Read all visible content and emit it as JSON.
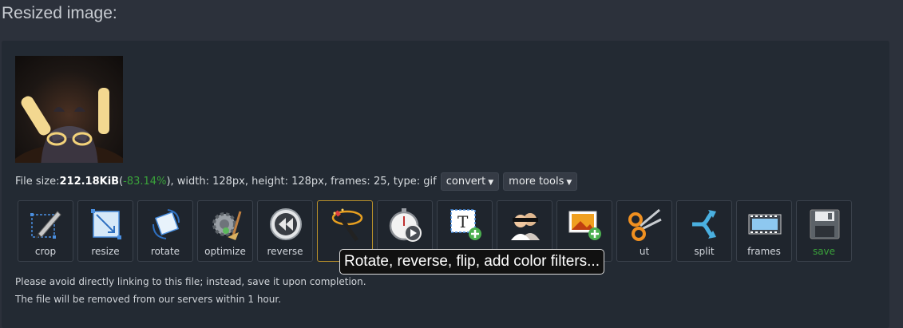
{
  "heading": "Resized image:",
  "file_info": {
    "size_label": "File size: ",
    "size_value": "212.18KiB",
    "paren_open": " (",
    "percent": "-83.14%",
    "rest": "), width: 128px, height: 128px, frames: 25, type: gif"
  },
  "buttons": {
    "convert": "convert",
    "more_tools": "more tools"
  },
  "tools": [
    {
      "label": "crop",
      "icon": "crop-icon"
    },
    {
      "label": "resize",
      "icon": "resize-icon"
    },
    {
      "label": "rotate",
      "icon": "rotate-icon"
    },
    {
      "label": "optimize",
      "icon": "optimize-icon"
    },
    {
      "label": "reverse",
      "icon": "reverse-icon"
    },
    {
      "label": "",
      "icon": "effects-wand-icon"
    },
    {
      "label": "",
      "icon": "speed-stopwatch-icon"
    },
    {
      "label": "",
      "icon": "write-text-icon"
    },
    {
      "label": "",
      "icon": "censor-icon"
    },
    {
      "label": "",
      "icon": "overlay-image-icon"
    },
    {
      "label": "ut",
      "icon": "cut-scissors-icon"
    },
    {
      "label": "split",
      "icon": "split-icon"
    },
    {
      "label": "frames",
      "icon": "frames-filmstrip-icon"
    },
    {
      "label": "save",
      "icon": "save-floppy-icon"
    }
  ],
  "tooltip": "Rotate, reverse, flip, add color filters...",
  "notes": [
    "Please avoid directly linking to this file; instead, save it upon completion.",
    "The file will be removed from our servers within 1 hour."
  ],
  "colors": {
    "page_bg": "#2c313b",
    "panel_bg": "#232a33",
    "savings_green": "#3aa23a",
    "selected_border": "#b8902a"
  }
}
